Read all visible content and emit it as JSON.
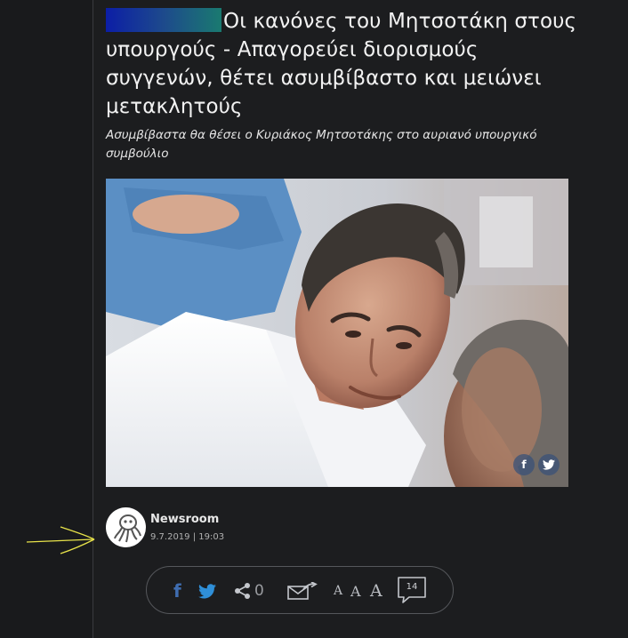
{
  "article": {
    "headline": "Οι κανόνες του Μητσοτάκη στους υπουργούς - Απαγορεύει διορισμούς συγγενών, θέτει ασυμβίβαστο και μειώνει μετακλητούς",
    "subtitle": "Ασυμβίβαστα θα θέσει ο Κυριάκος Μητσοτάκης στο αυριανό υπουργικό συμβούλιο"
  },
  "photo": {
    "share_facebook_icon": "facebook-icon",
    "share_twitter_icon": "twitter-icon"
  },
  "author": {
    "name": "Newsroom",
    "date": "9.7.2019 | 19:03",
    "avatar_icon": "octopus-logo-icon"
  },
  "share_bar": {
    "facebook_icon": "facebook-icon",
    "twitter_icon": "twitter-icon",
    "share_icon": "share-icon",
    "share_count": "0",
    "email_icon": "email-forward-icon",
    "font_small": "A",
    "font_medium": "A",
    "font_large": "A",
    "comment_count": "14"
  },
  "colors": {
    "background": "#1c1d1f",
    "facebook": "#3f6db0",
    "twitter": "#2f8fd8",
    "annotation_arrow": "#e8e34a",
    "redaction_start": "#0c1ea6",
    "redaction_end": "#1a7a70"
  }
}
